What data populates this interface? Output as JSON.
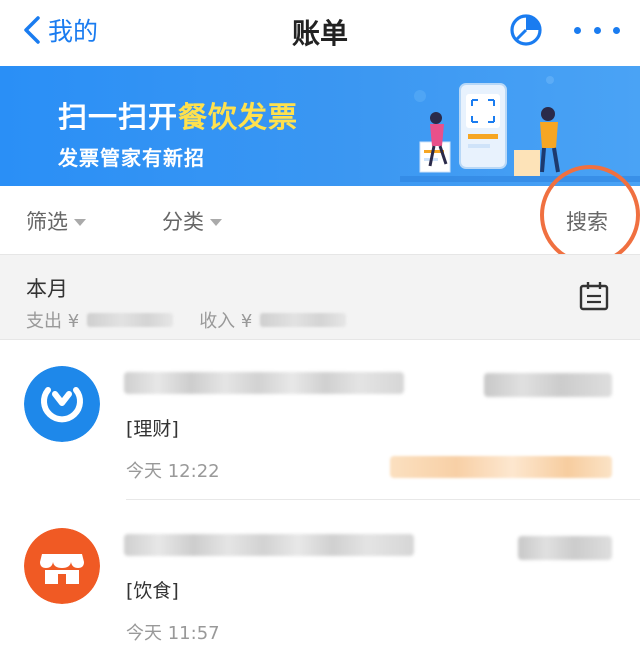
{
  "nav": {
    "back_label": "我的",
    "title": "账单",
    "chart_icon": "pie-chart-icon",
    "more_icon": "more-dots-icon"
  },
  "banner": {
    "line1_prefix": "扫一扫开",
    "line1_highlight": "餐饮发票",
    "line2": "发票管家有新招"
  },
  "filters": {
    "filter_label": "筛选",
    "category_label": "分类",
    "search_label": "搜索"
  },
  "month": {
    "title": "本月",
    "expense_label": "支出 ¥",
    "income_label": "收入 ¥",
    "calendar_icon": "calendar-icon"
  },
  "items": [
    {
      "category": "[理财]",
      "time": "今天  12:22",
      "icon": "wealth-icon"
    },
    {
      "category": "[饮食]",
      "time": "今天  11:57",
      "icon": "store-icon"
    }
  ],
  "colors": {
    "accent": "#1a7cf0",
    "banner": "#3b97f2",
    "highlight": "#ffe14d",
    "annotation": "#f07040",
    "wealth_icon_bg": "#1e88ea",
    "store_icon_bg": "#f05a24"
  }
}
